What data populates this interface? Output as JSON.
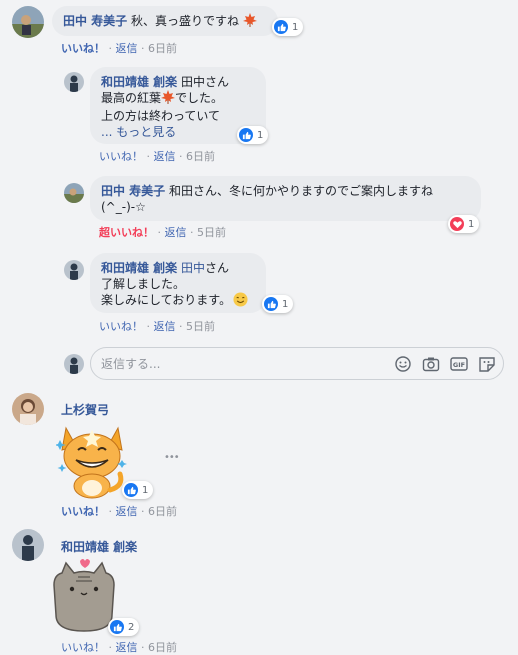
{
  "comments": [
    {
      "author": "田中 寿美子",
      "text": "秋、真っ盛りですね",
      "reaction_count": "1",
      "actions": {
        "like": "いいね！",
        "reply": "返信",
        "time": "6日前"
      }
    },
    {
      "author": "和田靖雄 創楽",
      "line1_tag": "田中さん",
      "line2": "最高の紅葉",
      "line2_tail": "でした。",
      "line3": "上の方は終わっていて",
      "see_more": "... もっと見る",
      "reaction_count": "1",
      "actions": {
        "like": "いいね！",
        "reply": "返信",
        "time": "6日前"
      }
    },
    {
      "author": "田中 寿美子",
      "text1": "和田さん、冬に何かやりますのでご案内しますね",
      "text2": "(^_-)-☆",
      "reaction_count": "1",
      "actions": {
        "like": "超いいね！",
        "reply": "返信",
        "time": "5日前"
      }
    },
    {
      "author": "和田靖雄 創楽",
      "tag": "田中",
      "tag_tail": "さん",
      "line2": "了解しました。",
      "line3": "楽しみにしております。",
      "reaction_count": "1",
      "actions": {
        "like": "いいね！",
        "reply": "返信",
        "time": "5日前"
      }
    },
    {
      "author": "上杉賀弓",
      "reaction_count": "1",
      "actions": {
        "like": "いいね！",
        "reply": "返信",
        "time": "6日前"
      },
      "more": "•••"
    },
    {
      "author": "和田靖雄 創楽",
      "reaction_count": "2",
      "actions": {
        "like": "いいね！",
        "reply": "返信",
        "time": "6日前"
      }
    }
  ],
  "reply_input": {
    "placeholder": "返信する..."
  },
  "separator": "·",
  "colors": {
    "link": "#365899",
    "action": "#4267b2",
    "love": "#f33e58",
    "bubble": "#e9ebee",
    "bg": "#f2f3f5"
  },
  "icons": [
    "maple-leaf-icon",
    "like-icon",
    "love-icon",
    "smile-emoji-icon",
    "emoji-icon",
    "camera-icon",
    "gif-icon",
    "sticker-icon",
    "cat-sticker",
    "pusheen-sticker"
  ]
}
